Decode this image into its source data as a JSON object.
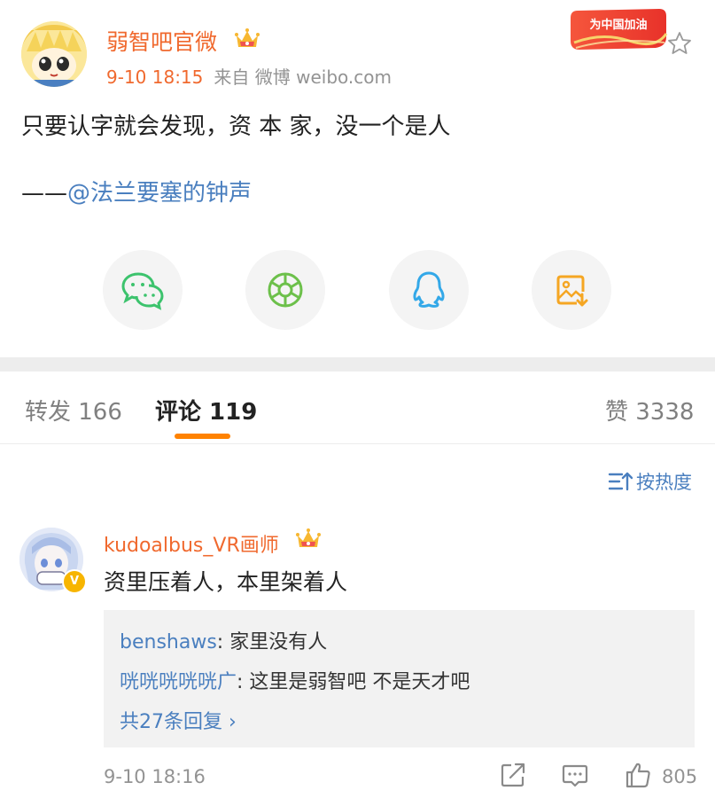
{
  "post": {
    "author": "弱智吧官微",
    "time": "9-10 18:15",
    "source": "来自 微博 weibo.com",
    "badge_text": "为中国加油",
    "line1": "只要认字就会发现，资 本 家，没一个是人",
    "line2_prefix": "——",
    "line2_mention": "@法兰要塞的钟声"
  },
  "share": [
    {
      "name": "wechat-icon"
    },
    {
      "name": "moments-icon"
    },
    {
      "name": "qq-icon"
    },
    {
      "name": "save-image-icon"
    }
  ],
  "tabs": {
    "repost": "转发 166",
    "comments": "评论 119",
    "likes": "赞 3338"
  },
  "sort_label": "按热度",
  "comment": {
    "author": "kudoalbus_VR画师",
    "text": "资里压着人，本里架着人",
    "replies": [
      {
        "who": "benshaws",
        "text": ": 家里没有人"
      },
      {
        "who": "咣咣咣咣咣广",
        "text": ": 这里是弱智吧 不是天才吧"
      }
    ],
    "more": "共27条回复 ›",
    "time": "9-10 18:16",
    "likes": "805"
  },
  "colors": {
    "accent": "#ff8200",
    "name": "#f0692e",
    "link": "#4a7fbf"
  }
}
